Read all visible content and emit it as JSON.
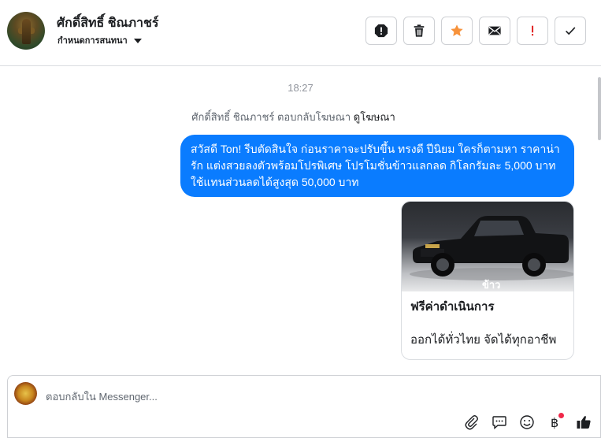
{
  "header": {
    "contact_name": "ศักดิ์สิทธิ์ ชิณภาชร์",
    "assign_label": "กำหนดการสนทนา",
    "actions": [
      "spam-icon",
      "trash-icon",
      "star-icon",
      "envelope-icon",
      "exclamation-icon",
      "checkmark-icon"
    ]
  },
  "conversation": {
    "timestamp": "18:27",
    "reply_context": "ศักดิ์สิทธิ์ ชิณภาชร์ ตอบกลับโฆษณา",
    "reply_link": "ดูโฆษณา",
    "message": "สวัสดี Ton! รีบตัดสินใจ ก่อนราคาจะปรับขึ้น ทรงดี ปีนิยม ใครก็ตามหา ราคาน่ารัก แต่งสวยลงตัวพร้อมโปรพิเศษ โปรโมชั่นข้าวแลกลด กิโลกรัมละ 5,000 บาท ใช้แทนส่วนลดได้สูงสุด 50,000 บาท",
    "card": {
      "image_watermark": "ข้าว",
      "title": "ฟรีค่าดำเนินการ",
      "subtitle": "ออกได้ทั่วไทย จัดได้ทุกอาชีพ"
    }
  },
  "composer": {
    "placeholder": "ตอบกลับใน Messenger...",
    "icons": [
      "paperclip-icon",
      "saved-reply-icon",
      "emoji-icon",
      "payment-icon",
      "thumbs-up-icon"
    ]
  },
  "colors": {
    "bubble": "#0a7cff",
    "star": "#f7923b",
    "exclamation": "#e02020",
    "badge_dot": "#f02849"
  }
}
